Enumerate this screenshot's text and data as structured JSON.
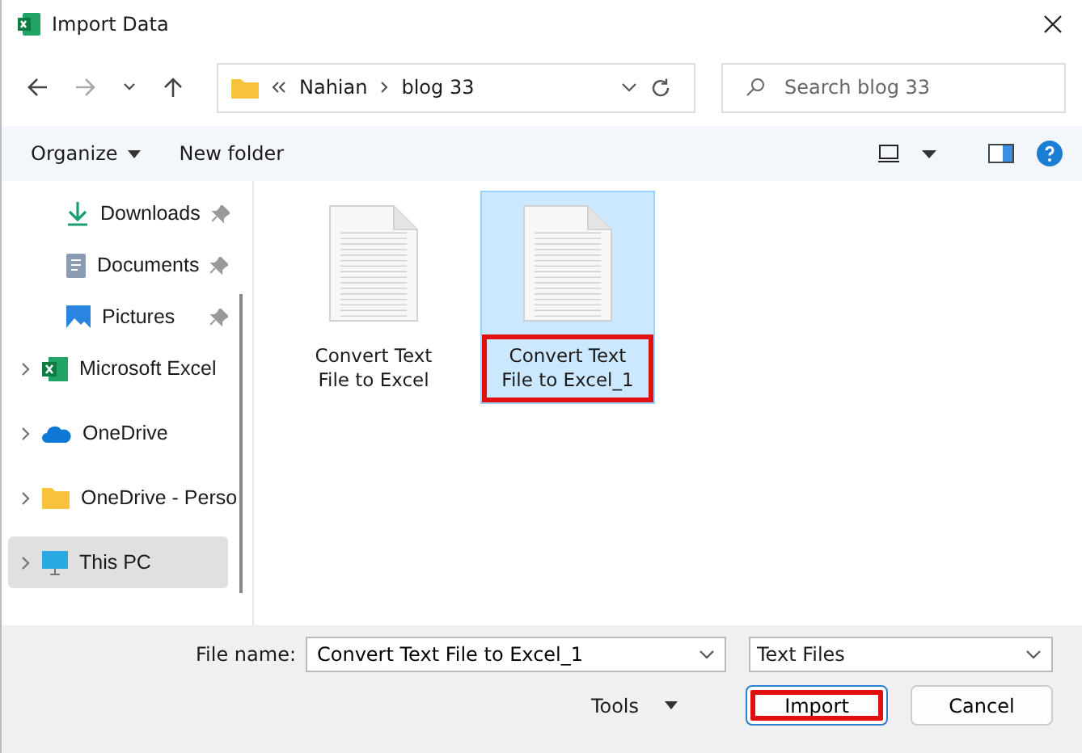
{
  "window": {
    "title": "Import Data"
  },
  "address": {
    "path": [
      {
        "label": "Nahian"
      },
      {
        "label": "blog 33"
      }
    ]
  },
  "search": {
    "placeholder": "Search blog 33"
  },
  "toolbar": {
    "organize": "Organize",
    "new_folder": "New folder"
  },
  "sidebar": {
    "items": [
      {
        "label": "Downloads",
        "kind": "downloads",
        "pinned": true,
        "expandable": false,
        "selected": false
      },
      {
        "label": "Documents",
        "kind": "documents",
        "pinned": true,
        "expandable": false,
        "selected": false
      },
      {
        "label": "Pictures",
        "kind": "pictures",
        "pinned": true,
        "expandable": false,
        "selected": false
      },
      {
        "label": "Microsoft Excel",
        "kind": "excel",
        "pinned": false,
        "expandable": true,
        "selected": false
      },
      {
        "label": "OneDrive",
        "kind": "cloud",
        "pinned": false,
        "expandable": true,
        "selected": false
      },
      {
        "label": "OneDrive - Perso",
        "kind": "folder",
        "pinned": false,
        "expandable": true,
        "selected": false
      },
      {
        "label": "This PC",
        "kind": "pc",
        "pinned": false,
        "expandable": true,
        "selected": true
      }
    ]
  },
  "files": [
    {
      "name": "Convert Text File to Excel",
      "selected": false,
      "highlighted": false
    },
    {
      "name": "Convert Text File to Excel_1",
      "selected": true,
      "highlighted": true
    }
  ],
  "footer": {
    "file_name_label": "File name:",
    "file_name": "Convert Text File to Excel_1",
    "file_type": "Text Files",
    "tools": "Tools",
    "buttons": [
      {
        "label": "Import",
        "highlighted": true
      },
      {
        "label": "Cancel",
        "highlighted": false
      }
    ]
  }
}
